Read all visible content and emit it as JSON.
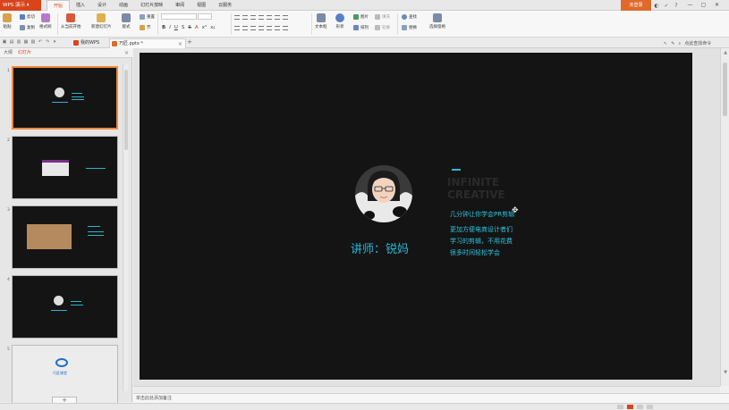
{
  "app": {
    "name": "WPS 演示",
    "menu_tabs": [
      "开始",
      "插入",
      "设计",
      "动画",
      "幻灯片放映",
      "审阅",
      "视图",
      "云服务"
    ],
    "active_tab": "开始",
    "login_label": "未登录"
  },
  "ribbon": {
    "paste": "粘贴",
    "cut": "剪切",
    "copy": "复制",
    "format_painter": "格式刷",
    "from_current": "从当前开始",
    "new_slide": "新建幻灯片",
    "layout": "版式",
    "reset": "重置",
    "section": "节",
    "textbox": "文本框",
    "shape": "形状",
    "picture": "图片",
    "fill": "填充",
    "arrange": "排列",
    "outline": "轮廓",
    "find": "查找",
    "replace": "替换",
    "select_pane": "选择窗格"
  },
  "doc_tabs": {
    "tab1": "我的WPS",
    "tab2": "巧匠.pptx *",
    "right_tool": "点此查找命令"
  },
  "left_panel": {
    "tab_outline": "大纲",
    "tab_slides": "幻灯片",
    "slide_numbers": [
      "1",
      "2",
      "3",
      "4",
      "5"
    ]
  },
  "slide": {
    "lecturer": "讲师：锐妈",
    "subtitle": "几分钟让你学会PR剪辑",
    "lines": [
      "更加方便电商设计者们",
      "学习的剪辑，不用花费",
      "很多时间轻松学会"
    ],
    "ghost_lines": [
      "INFINITE",
      "CREATIVE"
    ]
  },
  "thumb5": {
    "brand": "巧匠课堂"
  },
  "notes": {
    "placeholder": "单击此处添加备注"
  },
  "colors": {
    "accent": "#d9441b",
    "slide_bg": "#141414",
    "slide_text": "#28b7d4"
  }
}
